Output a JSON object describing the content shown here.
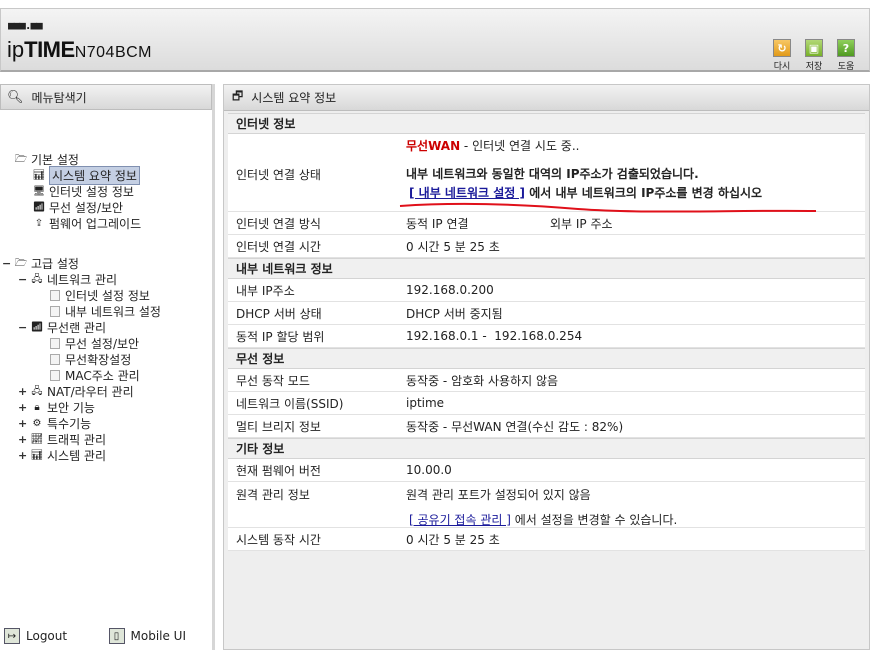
{
  "header": {
    "logo_dots": "■■■.■■",
    "logo_ip": "ip",
    "logo_time": "TIME",
    "logo_model": "N704BCM",
    "buttons": [
      {
        "label": "다시",
        "icon": "redo-icon"
      },
      {
        "label": "저장",
        "icon": "save-icon"
      },
      {
        "label": "도움",
        "icon": "help-icon"
      }
    ]
  },
  "sidebar": {
    "title": "메뉴탐색기",
    "basic": {
      "label": "기본 설정",
      "items": [
        "시스템 요약 정보",
        "인터넷 설정 정보",
        "무선 설정/보안",
        "펌웨어 업그레이드"
      ]
    },
    "advanced": {
      "label": "고급 설정",
      "network": {
        "label": "네트워크 관리",
        "items": [
          "인터넷 설정 정보",
          "내부 네트워크 설정"
        ]
      },
      "wireless": {
        "label": "무선랜 관리",
        "items": [
          "무선 설정/보안",
          "무선확장설정",
          "MAC주소 관리"
        ]
      },
      "others": [
        "NAT/라우터 관리",
        "보안 기능",
        "특수기능",
        "트래픽 관리",
        "시스템 관리"
      ]
    },
    "footer": {
      "logout": "Logout",
      "mobile": "Mobile UI"
    }
  },
  "main": {
    "title": "시스템 요약 정보",
    "internet": {
      "section": "인터넷 정보",
      "status_label": "인터넷 연결 상태",
      "status_wan": "무선WAN",
      "status_text": " - 인터넷 연결 시도 중..",
      "warning": "내부 네트워크와 동일한 대역의 IP주소가 검출되었습니다.",
      "link": "[ 내부 네트워크 설정 ]",
      "link_suffix": " 에서 내부 네트워크의 IP주소를 변경 하십시오",
      "method_label": "인터넷 연결 방식",
      "method_value": "동적 IP 연결",
      "external_ip_label": "외부 IP 주소",
      "time_label": "인터넷 연결 시간",
      "time_value": "0 시간 5 분 25 초"
    },
    "lan": {
      "section": "내부 네트워크 정보",
      "ip_label": "내부 IP주소",
      "ip_value": "192.168.0.200",
      "dhcp_label": "DHCP 서버 상태",
      "dhcp_value": "DHCP 서버 중지됨",
      "range_label": "동적 IP 할당 범위",
      "range_value": "192.168.0.1 -  192.168.0.254"
    },
    "wireless": {
      "section": "무선 정보",
      "mode_label": "무선 동작 모드",
      "mode_value": "동작중 - 암호화 사용하지 않음",
      "ssid_label": "네트워크 이름(SSID)",
      "ssid_value": "iptime",
      "bridge_label": "멀티 브리지 정보",
      "bridge_value": "동작중 - 무선WAN 연결(수신 감도 : 82%)"
    },
    "etc": {
      "section": "기타 정보",
      "fw_label": "현재 펌웨어 버전",
      "fw_value": "10.00.0",
      "remote_label": "원격 관리 정보",
      "remote_value": "원격 관리 포트가 설정되어 있지 않음",
      "remote_link": "[ 공유기 접속 관리 ]",
      "remote_link_suffix": " 에서 설정을 변경할 수 있습니다.",
      "uptime_label": "시스템 동작 시간",
      "uptime_value": "0 시간 5 분 25 초"
    }
  },
  "colors": {
    "accent_red": "#cc0000",
    "link_blue": "#1a1a9a",
    "annotation_red": "#e0101a"
  }
}
